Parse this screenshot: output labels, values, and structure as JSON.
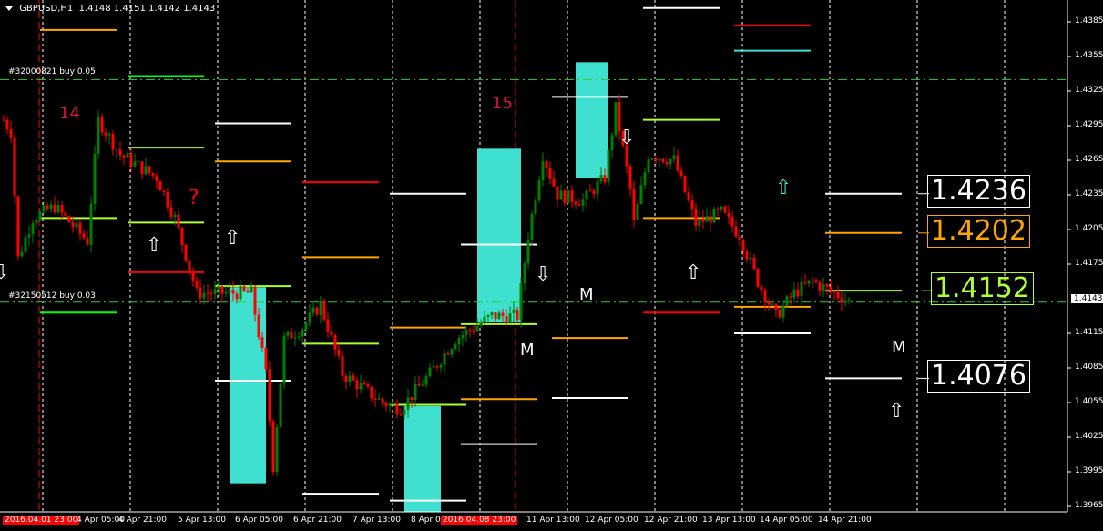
{
  "header": {
    "symbol": "GBPUSD,H1",
    "open": "1.4148",
    "high": "1.4151",
    "low": "1.4142",
    "close": "1.4143"
  },
  "orders": [
    {
      "label": "#32000821 buy 0.05",
      "price": 1.4335
    },
    {
      "label": "#32150512 buy 0.03",
      "price": 1.4142
    }
  ],
  "y_axis": {
    "ticks": [
      "1.4385",
      "1.4355",
      "1.4325",
      "1.4295",
      "1.4265",
      "1.4235",
      "1.4205",
      "1.4175",
      "1.4115",
      "1.4085",
      "1.4055",
      "1.4025",
      "1.3995",
      "1.3965"
    ],
    "current": "1.4143",
    "max": 1.4385,
    "min": 1.3965
  },
  "x_axis": {
    "ticks": [
      "4 Apr 05:00",
      "4 Apr 21:00",
      "5 Apr 13:00",
      "6 Apr 05:00",
      "6 Apr 21:00",
      "7 Apr 13:00",
      "8 Apr 05:00",
      "11 Apr 13:00",
      "12 Apr 05:00",
      "12 Apr 21:00",
      "13 Apr 13:00",
      "14 Apr 05:00",
      "14 Apr 21:00"
    ],
    "markers": [
      "2016.04.01 23:00",
      "2016.04.08 23:00"
    ]
  },
  "colors": {
    "bull": "#008000",
    "bear": "#ff0000",
    "box": "#40e0d0",
    "order_line": "#32cd32",
    "white": "#ffffff",
    "orange": "#ffa500",
    "lime": "#adff2f",
    "green": "#00ff00",
    "red": "#ff0000",
    "cyan": "#40e0d0"
  },
  "price_path": [
    [
      1,
      1.43
    ],
    [
      3,
      1.429
    ],
    [
      5,
      1.418
    ],
    [
      9,
      1.4215
    ],
    [
      15,
      1.4225
    ],
    [
      24,
      1.4195
    ],
    [
      27,
      1.43
    ],
    [
      33,
      1.427
    ],
    [
      43,
      1.425
    ],
    [
      48,
      1.4215
    ],
    [
      54,
      1.415
    ],
    [
      60,
      1.415
    ],
    [
      69,
      1.415
    ],
    [
      73,
      1.408
    ],
    [
      75,
      1.4
    ],
    [
      78,
      1.411
    ],
    [
      83,
      1.412
    ],
    [
      88,
      1.414
    ],
    [
      94,
      1.408
    ],
    [
      105,
      1.4055
    ],
    [
      110,
      1.405
    ],
    [
      118,
      1.408
    ],
    [
      125,
      1.411
    ],
    [
      135,
      1.413
    ],
    [
      142,
      1.413
    ],
    [
      145,
      1.42
    ],
    [
      149,
      1.427
    ],
    [
      153,
      1.4235
    ],
    [
      160,
      1.423
    ],
    [
      166,
      1.425
    ],
    [
      169,
      1.431
    ],
    [
      173,
      1.424
    ],
    [
      174,
      1.421
    ],
    [
      178,
      1.427
    ],
    [
      185,
      1.4265
    ],
    [
      191,
      1.421
    ],
    [
      198,
      1.422
    ],
    [
      203,
      1.42
    ],
    [
      208,
      1.416
    ],
    [
      213,
      1.413
    ],
    [
      218,
      1.415
    ],
    [
      223,
      1.416
    ],
    [
      233,
      1.4143
    ]
  ],
  "levels": [
    {
      "session": 0,
      "price": 1.4378,
      "color": "orange"
    },
    {
      "session": 0,
      "price": 1.4215,
      "color": "lime"
    },
    {
      "session": 0,
      "price": 1.4133,
      "color": "green"
    },
    {
      "session": 1,
      "price": 1.4338,
      "color": "green"
    },
    {
      "session": 1,
      "price": 1.4276,
      "color": "lime"
    },
    {
      "session": 1,
      "price": 1.4211,
      "color": "lime"
    },
    {
      "session": 1,
      "price": 1.4168,
      "color": "red"
    },
    {
      "session": 2,
      "price": 1.4297,
      "color": "white"
    },
    {
      "session": 2,
      "price": 1.4264,
      "color": "orange"
    },
    {
      "session": 2,
      "price": 1.4156,
      "color": "lime"
    },
    {
      "session": 2,
      "price": 1.4074,
      "color": "white"
    },
    {
      "session": 3,
      "price": 1.4246,
      "color": "red"
    },
    {
      "session": 3,
      "price": 1.4181,
      "color": "orange"
    },
    {
      "session": 3,
      "price": 1.4106,
      "color": "lime"
    },
    {
      "session": 3,
      "price": 1.3976,
      "color": "white"
    },
    {
      "session": 4,
      "price": 1.4236,
      "color": "white"
    },
    {
      "session": 4,
      "price": 1.412,
      "color": "orange"
    },
    {
      "session": 4,
      "price": 1.4053,
      "color": "lime"
    },
    {
      "session": 4,
      "price": 1.397,
      "color": "white"
    },
    {
      "session": 5,
      "price": 1.4192,
      "color": "white"
    },
    {
      "session": 5,
      "price": 1.4123,
      "color": "lime"
    },
    {
      "session": 5,
      "price": 1.4058,
      "color": "orange"
    },
    {
      "session": 5,
      "price": 1.4019,
      "color": "white"
    },
    {
      "session": 6,
      "price": 1.432,
      "color": "white"
    },
    {
      "session": 6,
      "price": 1.4111,
      "color": "orange"
    },
    {
      "session": 6,
      "price": 1.4059,
      "color": "white"
    },
    {
      "session": 7,
      "price": 1.4397,
      "color": "white"
    },
    {
      "session": 7,
      "price": 1.43,
      "color": "lime"
    },
    {
      "session": 7,
      "price": 1.4215,
      "color": "orange"
    },
    {
      "session": 7,
      "price": 1.4133,
      "color": "red"
    },
    {
      "session": 8,
      "price": 1.4382,
      "color": "red"
    },
    {
      "session": 8,
      "price": 1.436,
      "color": "cyan"
    },
    {
      "session": 8,
      "price": 1.4138,
      "color": "orange"
    },
    {
      "session": 8,
      "price": 1.4115,
      "color": "white"
    },
    {
      "session": 9,
      "price": 1.4236,
      "color": "white"
    },
    {
      "session": 9,
      "price": 1.4202,
      "color": "orange"
    },
    {
      "session": 9,
      "price": 1.4152,
      "color": "lime"
    },
    {
      "session": 9,
      "price": 1.4076,
      "color": "white"
    }
  ],
  "boxes": [
    {
      "bar_from": 63,
      "bar_to": 73,
      "high": 1.4155,
      "low": 1.3985
    },
    {
      "bar_from": 111,
      "bar_to": 121,
      "high": 1.4052,
      "low": 1.396
    },
    {
      "bar_from": 131,
      "bar_to": 143,
      "high": 1.4275,
      "low": 1.4125
    },
    {
      "bar_from": 158,
      "bar_to": 167,
      "high": 1.435,
      "low": 1.425
    }
  ],
  "price_labels": [
    {
      "text": "1.4236",
      "color": "white"
    },
    {
      "text": "1.4202",
      "color": "orange"
    },
    {
      "text": "1.4152",
      "color": "lime"
    },
    {
      "text": "1.4076",
      "color": "white"
    }
  ],
  "notes": {
    "n14": "14",
    "n15": "15",
    "question": "?",
    "m1": "M",
    "m2": "M",
    "m3": "M"
  },
  "arrows": {
    "up": "⇧",
    "down": "⇩"
  }
}
